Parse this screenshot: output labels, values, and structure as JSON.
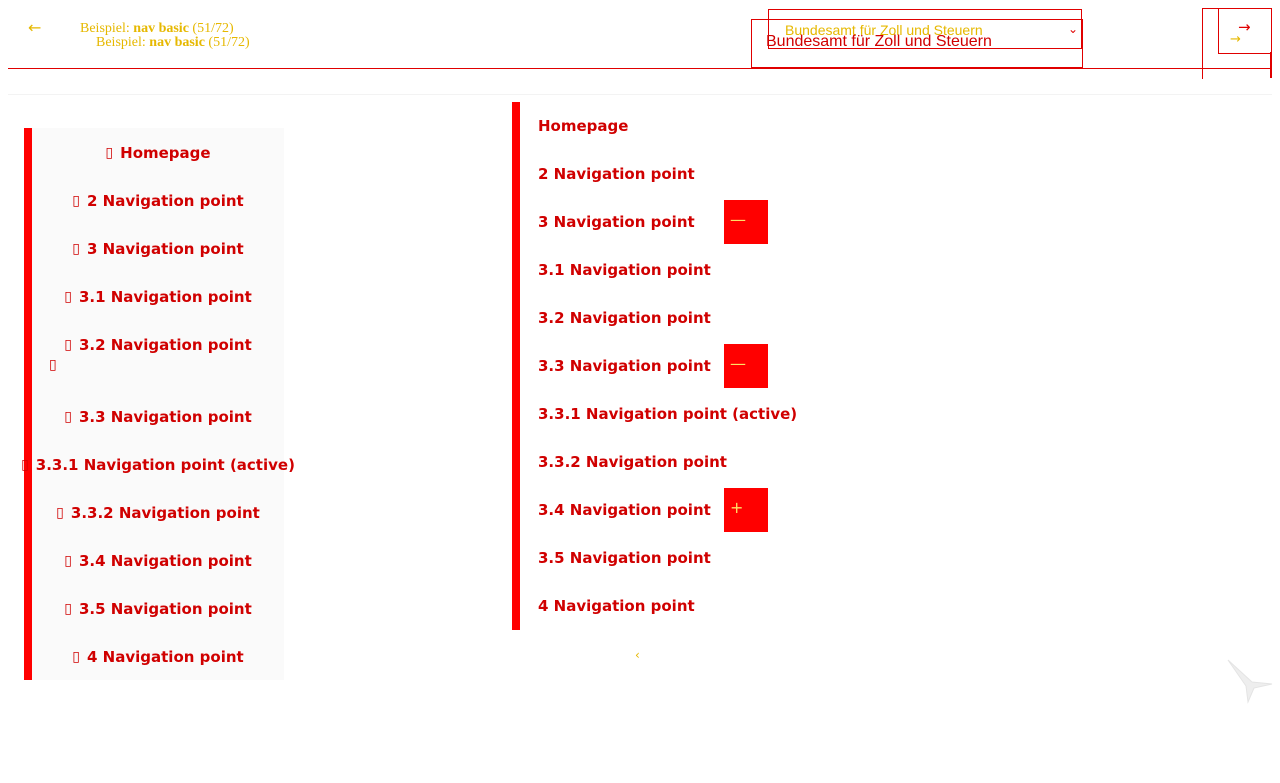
{
  "header": {
    "back_icon": "arrow-left-icon",
    "title_prefix": "Beispiel:",
    "title_name": "nav basic",
    "title_count": "(51/72)",
    "select_value": "Bundesamt für Zoll und Steuern",
    "next_icon": "arrow-right-icon"
  },
  "left_nav": {
    "items": [
      {
        "label": "Homepage"
      },
      {
        "label": "2 Navigation point"
      },
      {
        "label": "3 Navigation point"
      },
      {
        "label": "3.1 Navigation point"
      },
      {
        "label": "3.2 Navigation point"
      },
      {
        "label": "3.3 Navigation point"
      },
      {
        "label": "3.3.1 Navigation point (active)"
      },
      {
        "label": "3.3.2 Navigation point"
      },
      {
        "label": "3.4 Navigation point"
      },
      {
        "label": "3.5 Navigation point"
      },
      {
        "label": "4 Navigation point"
      }
    ],
    "missing_glyph": "▯"
  },
  "right_nav": {
    "items": [
      {
        "label": "Homepage"
      },
      {
        "label": "2 Navigation point"
      },
      {
        "label": "3 Navigation point",
        "toggle": "—"
      },
      {
        "label": "3.1 Navigation point"
      },
      {
        "label": "3.2 Navigation point"
      },
      {
        "label": "3.3 Navigation point",
        "toggle": "—"
      },
      {
        "label": "3.3.1 Navigation point (active)"
      },
      {
        "label": "3.3.2 Navigation point"
      },
      {
        "label": "3.4 Navigation point",
        "toggle": "+"
      },
      {
        "label": "3.5 Navigation point"
      },
      {
        "label": "4 Navigation point"
      }
    ]
  },
  "colors": {
    "accent": "#ff0000",
    "text": "#d00000",
    "highlight": "#e6b800"
  }
}
